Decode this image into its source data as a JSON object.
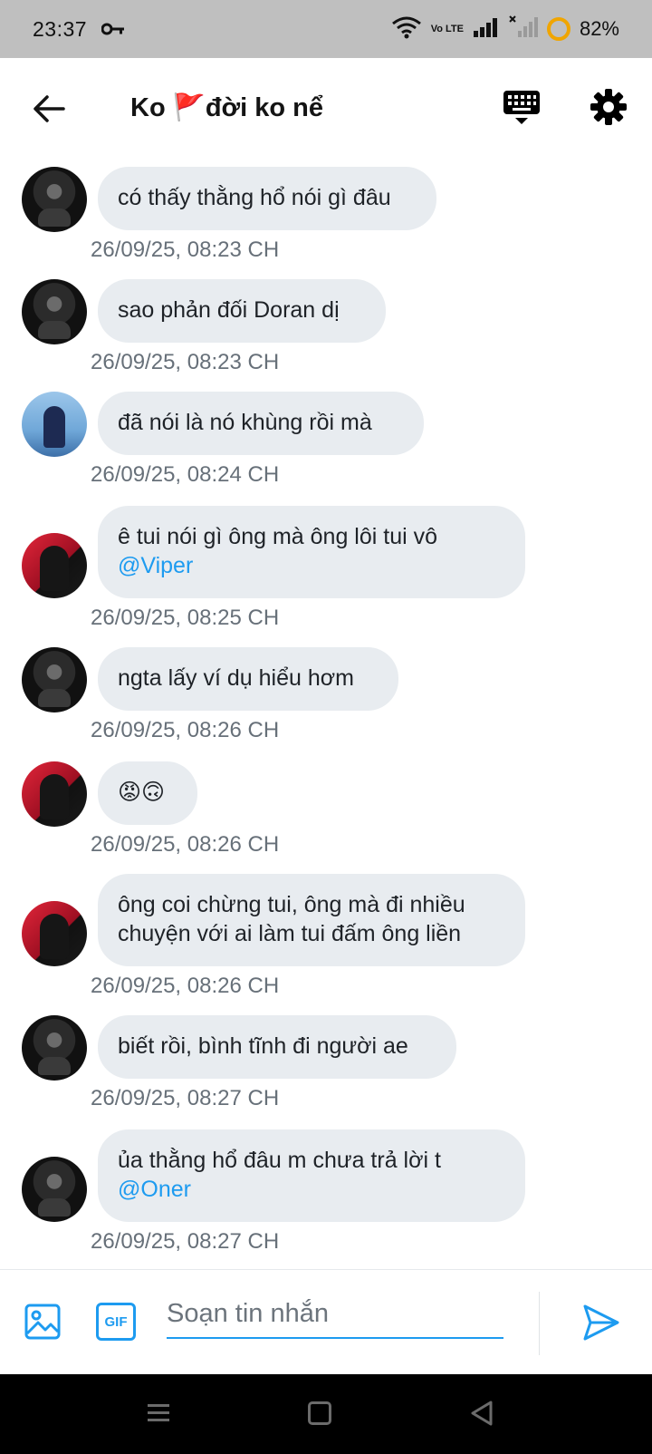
{
  "status_bar": {
    "time": "23:37",
    "network_label": "Vo LTE",
    "battery_percent": "82%",
    "battery_level": 0.82
  },
  "header": {
    "title": "Ko 🚩đời ko nể"
  },
  "messages": [
    {
      "avatar": "dark",
      "text": "có thấy thằng hổ nói gì đâu",
      "timestamp": "26/09/25, 08:23 CH"
    },
    {
      "avatar": "dark",
      "text": "sao phản đối Doran dị",
      "timestamp": "26/09/25, 08:23 CH"
    },
    {
      "avatar": "blue",
      "text": "đã nói là nó khùng rồi mà",
      "timestamp": "26/09/25, 08:24 CH"
    },
    {
      "avatar": "red",
      "text": "ê tui nói gì ông mà ông lôi tui vô",
      "mention": "@Viper",
      "timestamp": "26/09/25, 08:25 CH"
    },
    {
      "avatar": "dark",
      "text": "ngta lấy ví dụ hiểu hơm",
      "timestamp": "26/09/25, 08:26 CH"
    },
    {
      "avatar": "red",
      "text": "😡🙃",
      "timestamp": "26/09/25, 08:26 CH"
    },
    {
      "avatar": "red",
      "text": "ông coi chừng tui, ông mà đi nhiều chuyện với ai làm tui đấm ông liền",
      "timestamp": "26/09/25, 08:26 CH"
    },
    {
      "avatar": "dark",
      "text": "biết rồi, bình tĩnh đi người ae",
      "timestamp": "26/09/25, 08:27 CH"
    },
    {
      "avatar": "dark",
      "text": "ủa thằng hổ đâu m chưa trả lời t",
      "mention": "@Oner",
      "timestamp": "26/09/25, 08:27 CH"
    }
  ],
  "composer": {
    "gif_label": "GIF",
    "placeholder": "Soạn tin nhắn"
  },
  "colors": {
    "accent": "#1d9bf0",
    "bubble": "#e8ecf0",
    "timestamp": "#677079"
  },
  "icons": {
    "back": "back-arrow-icon",
    "keyboard": "keyboard-icon",
    "settings": "gear-icon",
    "image": "image-icon",
    "gif": "gif-icon",
    "send": "send-icon"
  }
}
